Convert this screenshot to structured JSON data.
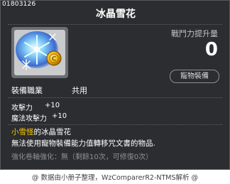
{
  "item": {
    "id": "01803126",
    "name": "冰晶雪花",
    "icon": "snowflake-crystal-with-gold-coin-icon"
  },
  "power": {
    "label": "戰鬥力提升量",
    "value": "0"
  },
  "badge": "寵物裝備",
  "job": {
    "label": "裝備職業",
    "value": "共用"
  },
  "stats": [
    {
      "label": "攻擊力",
      "value": "+10"
    },
    {
      "label": "魔法攻擊力",
      "value": "+10"
    }
  ],
  "description": {
    "highlight": "小雪怪",
    "rest": "的冰晶雪花",
    "line2": "無法使用寵物裝備能力值轉移咒文書的物品."
  },
  "enhance": "強化卷軸強化：無（剩餘10次，可修復0次）",
  "footer": "@ 数据由小册子整理，WzComparerR2-NTMS解析 @",
  "colors": {
    "background": "#2b2d31",
    "highlight": "#ffcc00",
    "muted": "#8e9095"
  }
}
